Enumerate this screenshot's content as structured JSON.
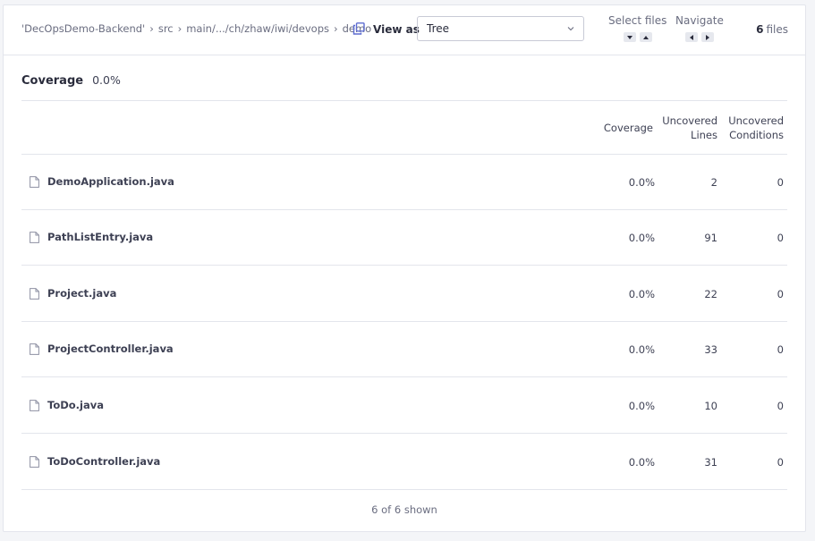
{
  "breadcrumb": {
    "items": [
      "'DecOpsDemo-Backend'",
      "src",
      "main/.../ch/zhaw/iwi/devops",
      "demo"
    ]
  },
  "view_as": {
    "label": "View as",
    "selected": "Tree"
  },
  "select_files": {
    "label": "Select files"
  },
  "navigate": {
    "label": "Navigate"
  },
  "files_count": {
    "count": "6",
    "unit": "files"
  },
  "coverage": {
    "label": "Coverage",
    "value": "0.0%"
  },
  "table": {
    "headers": {
      "coverage": "Coverage",
      "uncovered_lines_1": "Uncovered",
      "uncovered_lines_2": "Lines",
      "uncovered_conditions_1": "Uncovered",
      "uncovered_conditions_2": "Conditions"
    },
    "rows": [
      {
        "name": "DemoApplication.java",
        "coverage": "0.0%",
        "uncovered_lines": "2",
        "uncovered_conditions": "0"
      },
      {
        "name": "PathListEntry.java",
        "coverage": "0.0%",
        "uncovered_lines": "91",
        "uncovered_conditions": "0"
      },
      {
        "name": "Project.java",
        "coverage": "0.0%",
        "uncovered_lines": "22",
        "uncovered_conditions": "0"
      },
      {
        "name": "ProjectController.java",
        "coverage": "0.0%",
        "uncovered_lines": "33",
        "uncovered_conditions": "0"
      },
      {
        "name": "ToDo.java",
        "coverage": "0.0%",
        "uncovered_lines": "10",
        "uncovered_conditions": "0"
      },
      {
        "name": "ToDoController.java",
        "coverage": "0.0%",
        "uncovered_lines": "31",
        "uncovered_conditions": "0"
      }
    ]
  },
  "footer": {
    "shown": "6 of 6 shown"
  },
  "colors": {
    "accent": "#5d6cd0",
    "text": "#2a2c3c",
    "muted": "#6a6d80",
    "border": "#e3e5ec"
  }
}
